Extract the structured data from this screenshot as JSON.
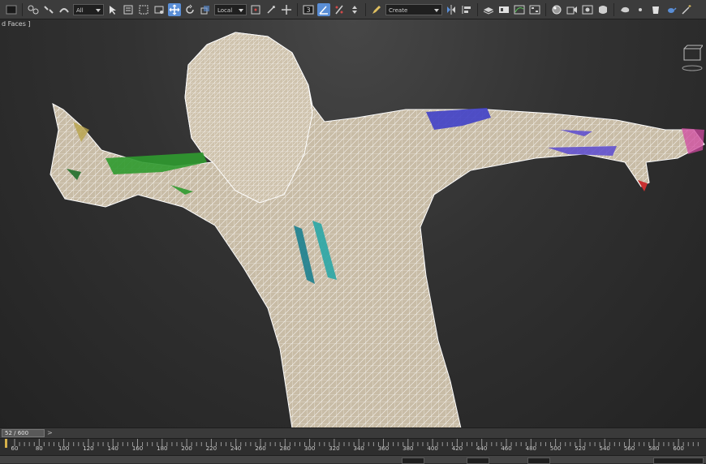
{
  "toolbar": {
    "selection_filter": "All",
    "reference_coord_system": "Local",
    "named_selection_set": "Create Selection Se",
    "icons": [
      "undo-icon",
      "redo-icon",
      "link-icon",
      "unlink-icon",
      "bind-space-warp-icon",
      "select-object-icon",
      "select-by-name-icon",
      "rectangular-selection-icon",
      "window-crossing-icon",
      "select-and-move-icon",
      "select-and-rotate-icon",
      "select-and-scale-icon",
      "select-and-place-icon",
      "pivot-center-icon",
      "select-manipulate-icon",
      "keyboard-shortcut-icon",
      "snaps-toggle-icon",
      "angle-snap-icon",
      "percent-snap-icon",
      "spinner-snap-icon",
      "edit-named-selection-icon",
      "mirror-icon",
      "align-icon",
      "layer-explorer-icon",
      "toggle-ribbon-icon",
      "curve-editor-icon",
      "schematic-view-icon",
      "material-editor-icon",
      "render-setup-icon",
      "rendered-frame-window-icon",
      "render-production-icon",
      "render-online-icon",
      "teapot-icon",
      "arnold-icon",
      "civil-view-icon"
    ]
  },
  "viewport": {
    "label": "d Faces ]"
  },
  "time_slider": {
    "position": "52 / 600",
    "current_frame": 52,
    "total_frames": 600,
    "next_label": ">"
  },
  "track_bar": {
    "tick_labels": [
      "60",
      "80",
      "100",
      "120",
      "140",
      "160",
      "180",
      "200",
      "220",
      "240",
      "260",
      "280",
      "300",
      "320",
      "340",
      "360",
      "380",
      "400",
      "420",
      "440",
      "460",
      "480",
      "500",
      "520",
      "540",
      "560",
      "580",
      "600"
    ]
  },
  "colors": {
    "mesh_skin": "#c8bca6",
    "wire": "#ffffff",
    "poly_green": "#2f9a2f",
    "poly_blue": "#4040c8",
    "poly_teal": "#2aa6a6",
    "poly_pink": "#d04aa0",
    "active_button": "#5a8ed6"
  }
}
